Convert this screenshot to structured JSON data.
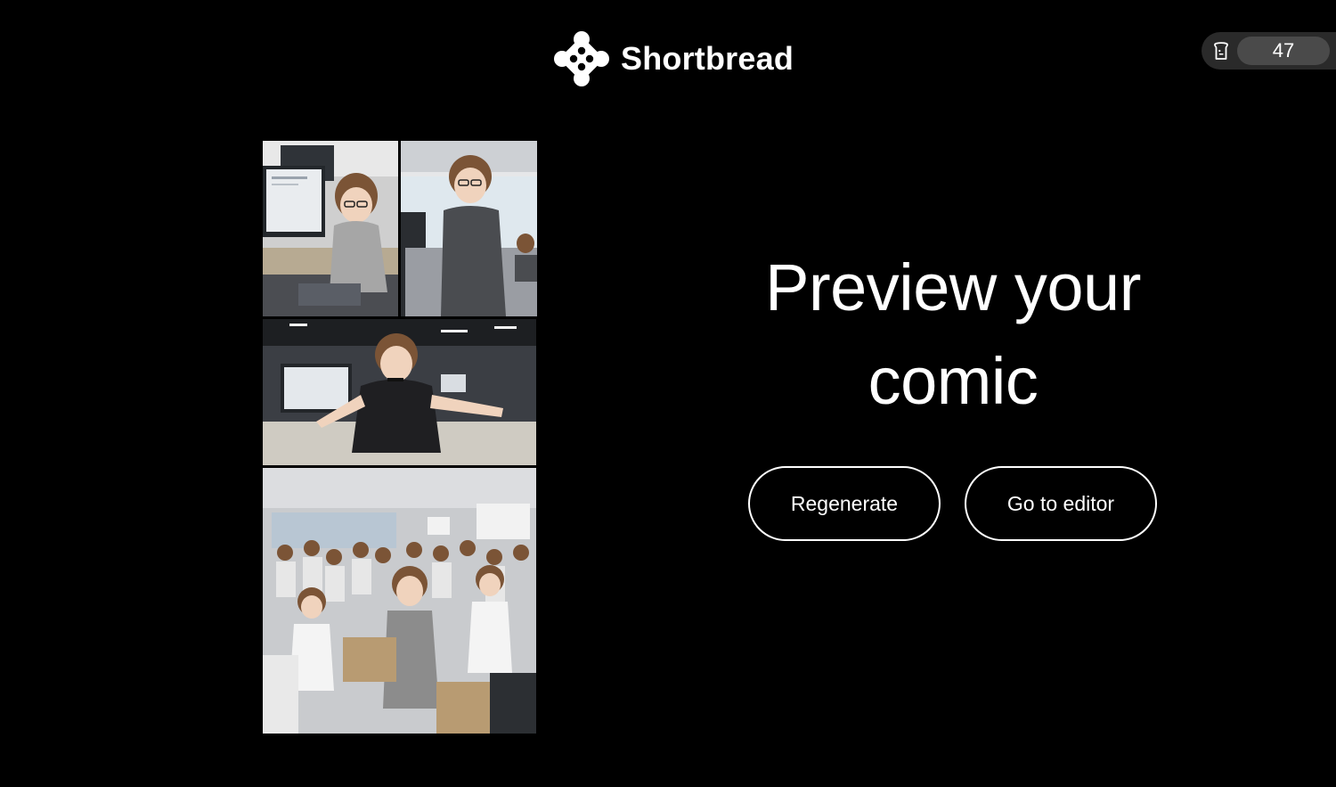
{
  "header": {
    "app_name": "Shortbread",
    "logo_icon": "shortbread-logo-icon"
  },
  "credits": {
    "icon": "bread-slice-icon",
    "count": "47"
  },
  "main": {
    "heading": "Preview your comic",
    "buttons": {
      "regenerate": "Regenerate",
      "go_to_editor": "Go to editor"
    }
  },
  "comic": {
    "panels": [
      "comic-panel-1",
      "comic-panel-2",
      "comic-panel-3",
      "comic-panel-4"
    ]
  },
  "colors": {
    "background": "#000000",
    "text": "#ffffff",
    "pill_outer": "#2a2a2a",
    "pill_inner": "#4a4a4a"
  }
}
